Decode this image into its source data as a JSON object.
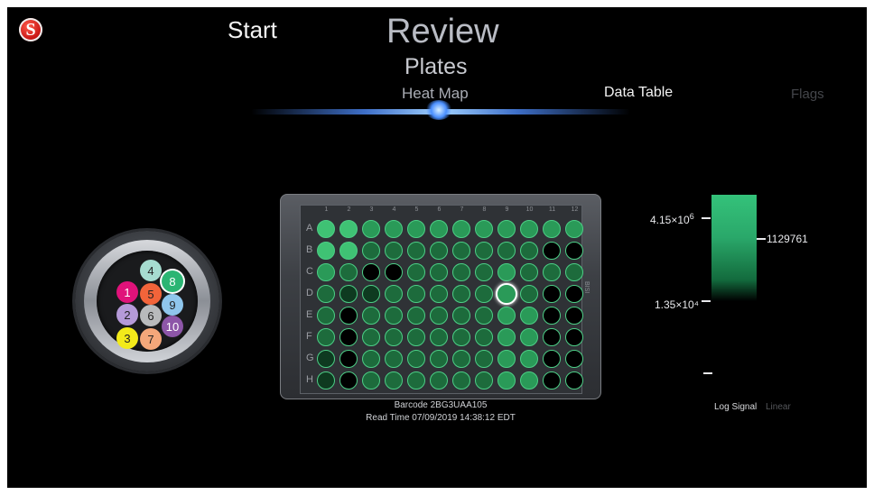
{
  "nav": {
    "start": "Start",
    "review": "Review",
    "plates": "Plates",
    "heat_map": "Heat Map",
    "data_table": "Data Table",
    "flags": "Flags"
  },
  "logo": {
    "letter": "S",
    "color": "#d4141a"
  },
  "selector": {
    "slots": [
      {
        "label": "1",
        "color": "#e0127a"
      },
      {
        "label": "2",
        "color": "#b59ad8"
      },
      {
        "label": "3",
        "color": "#f2ea1a"
      },
      {
        "label": "4",
        "color": "#a6dcd0"
      },
      {
        "label": "5",
        "color": "#f2643a"
      },
      {
        "label": "6",
        "color": "#b8babc"
      },
      {
        "label": "7",
        "color": "#f4a77a"
      },
      {
        "label": "8",
        "color": "#2bb573",
        "selected": true
      },
      {
        "label": "9",
        "color": "#8fc6ec"
      },
      {
        "label": "10",
        "color": "#8d56a8"
      }
    ]
  },
  "plate": {
    "columns": [
      "1",
      "2",
      "3",
      "4",
      "5",
      "6",
      "7",
      "8",
      "9",
      "10",
      "11",
      "12"
    ],
    "rows": [
      "A",
      "B",
      "C",
      "D",
      "E",
      "F",
      "G",
      "H"
    ],
    "side_label": "BISI",
    "well_levels": [
      [
        4,
        4,
        3,
        3,
        3,
        3,
        3,
        3,
        3,
        3,
        3,
        3
      ],
      [
        4,
        4,
        2,
        2,
        2,
        2,
        2,
        2,
        2,
        2,
        0,
        0
      ],
      [
        3,
        2,
        0,
        0,
        2,
        2,
        2,
        2,
        3,
        2,
        2,
        2
      ],
      [
        2,
        1,
        1,
        2,
        2,
        2,
        2,
        2,
        4,
        2,
        0,
        0
      ],
      [
        2,
        0,
        2,
        2,
        2,
        2,
        2,
        2,
        3,
        3,
        0,
        0
      ],
      [
        2,
        0,
        2,
        2,
        2,
        2,
        2,
        2,
        3,
        3,
        0,
        0
      ],
      [
        1,
        0,
        2,
        2,
        2,
        2,
        2,
        2,
        3,
        3,
        0,
        0
      ],
      [
        1,
        0,
        2,
        2,
        2,
        2,
        2,
        2,
        3,
        3,
        0,
        0
      ]
    ],
    "selected_well": "D9",
    "barcode": "Barcode 2BG3UAA105",
    "read_time": "Read Time 07/09/2019 14:38:12 EDT"
  },
  "scale": {
    "top_label_base": "4.15×10",
    "top_label_exp": "6",
    "mid_label": "1.35×10⁴",
    "value_label": "1129761",
    "colors": {
      "high": "#34c27a",
      "low": "#000000"
    },
    "mode_log": "Log Signal",
    "mode_linear": "Linear"
  }
}
